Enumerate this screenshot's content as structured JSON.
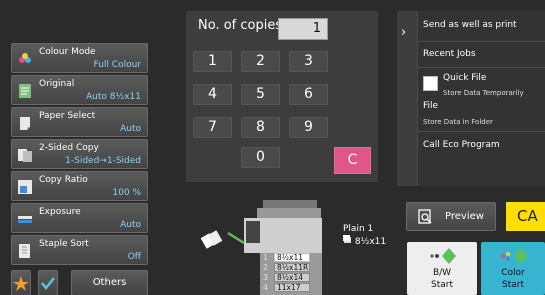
{
  "settings": [
    {
      "label": "Colour Mode",
      "value": "Full Colour",
      "icon": "colour-mode-icon"
    },
    {
      "label": "Original",
      "value": "Auto 8½x11",
      "icon": "original-icon"
    },
    {
      "label": "Paper Select",
      "value": "Auto",
      "icon": "paper-select-icon"
    },
    {
      "label": "2-Sided Copy",
      "value": "1-Sided→1-Sided",
      "icon": "two-sided-icon"
    },
    {
      "label": "Copy Ratio",
      "value": "100 %",
      "icon": "copy-ratio-icon"
    },
    {
      "label": "Exposure",
      "value": "Auto",
      "icon": "exposure-icon"
    },
    {
      "label": "Staple Sort",
      "value": "Off",
      "icon": "staple-sort-icon"
    }
  ],
  "bottom": {
    "star_icon": "star-icon",
    "check_icon": "check-icon",
    "others_label": "Others"
  },
  "keypad": {
    "copies_label": "No. of copies",
    "copies_value": "1",
    "keys": [
      "1",
      "2",
      "3",
      "4",
      "5",
      "6",
      "7",
      "8",
      "9",
      "0"
    ],
    "clear_label": "C"
  },
  "right_panel": {
    "items": {
      "send_print": "Send as well as print",
      "recent_jobs": "Recent Jobs",
      "quick_file": "Quick File",
      "quick_file_sub": "Store Data Temporarily",
      "file": "File",
      "file_sub": "Store Data in Folder",
      "call_eco": "Call Eco Program"
    }
  },
  "machine": {
    "trays": [
      {
        "num": "1",
        "size": "8½x11"
      },
      {
        "num": "2",
        "size": "8½x11R"
      },
      {
        "num": "3",
        "size": "8½x14"
      },
      {
        "num": "4",
        "size": "11x17"
      }
    ],
    "selected_tray": 1,
    "paper_type": "Plain 1",
    "paper_size": "8½x11"
  },
  "actions": {
    "preview_label": "Preview",
    "ca_label": "CA",
    "bw_start": {
      "line1": "B/W",
      "line2": "Start"
    },
    "colour_start": {
      "line1": "Color",
      "line2": "Start"
    }
  },
  "colors": {
    "accent_value": "#8ed0f0",
    "clear_key": "#e0558a",
    "ca_button": "#ffdd00",
    "colour_start": "#36b4d0",
    "bw_start": "#eeeeee"
  }
}
